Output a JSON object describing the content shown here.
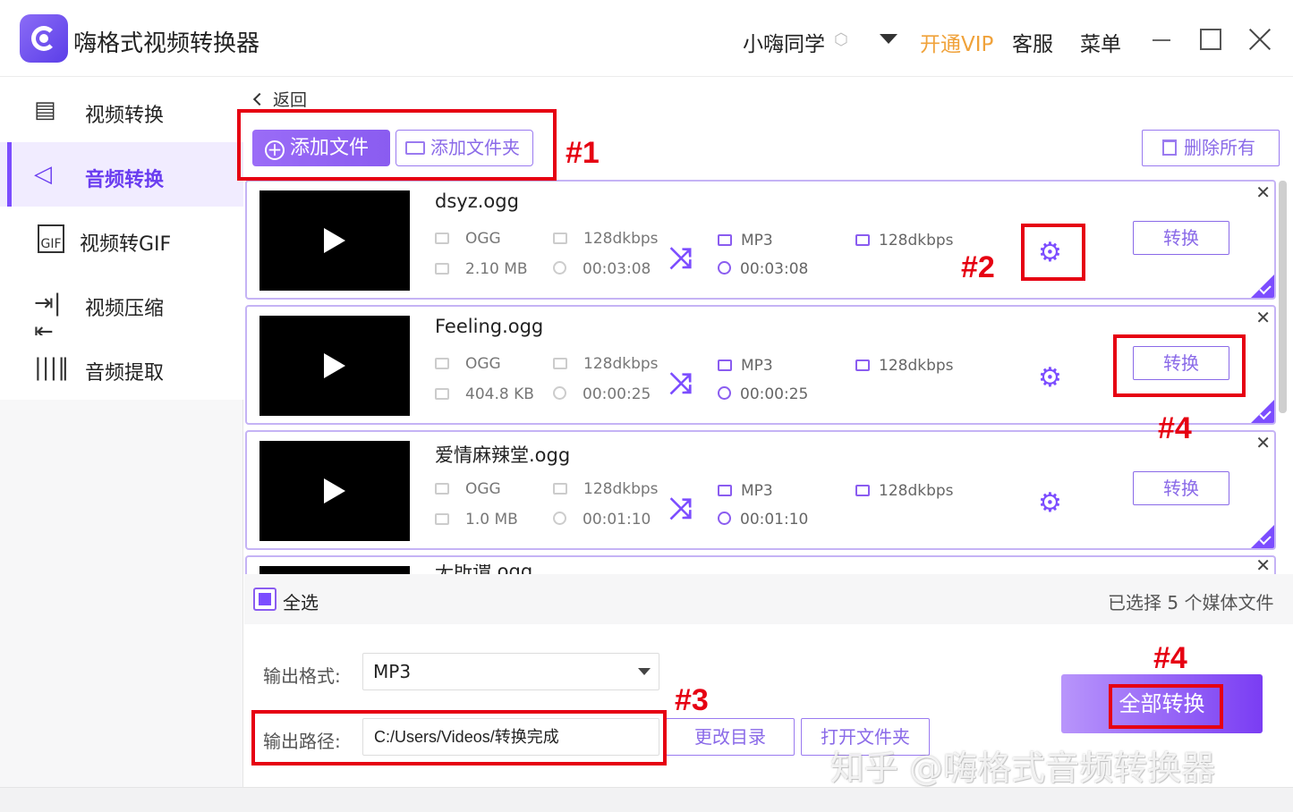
{
  "app": {
    "title": "嗨格式视频转换器",
    "user": "小嗨同学",
    "vip": "开通VIP",
    "service": "客服",
    "menu": "菜单",
    "accent_color": "#7c4dff",
    "vip_color": "#f0a23a"
  },
  "sidebar": {
    "items": [
      {
        "label": "视频转换",
        "icon": "video-convert-icon",
        "active": false
      },
      {
        "label": "音频转换",
        "icon": "audio-convert-icon",
        "active": true
      },
      {
        "label": "视频转GIF",
        "icon": "gif-icon",
        "active": false
      },
      {
        "label": "视频压缩",
        "icon": "compress-icon",
        "active": false
      },
      {
        "label": "音频提取",
        "icon": "audio-extract-icon",
        "active": false
      }
    ]
  },
  "toolbar": {
    "back": "返回",
    "add_file": "添加文件",
    "add_folder": "添加文件夹",
    "delete_all": "删除所有"
  },
  "files": [
    {
      "name": "dsyz.ogg",
      "format": "OGG",
      "bitrate": "128dkbps",
      "size": "2.10 MB",
      "duration": "00:03:08",
      "out_format": "MP3",
      "out_bitrate": "128dkbps",
      "out_duration": "00:03:08",
      "convert": "转换"
    },
    {
      "name": "Feeling.ogg",
      "format": "OGG",
      "bitrate": "128dkbps",
      "size": "404.8 KB",
      "duration": "00:00:25",
      "out_format": "MP3",
      "out_bitrate": "128dkbps",
      "out_duration": "00:00:25",
      "convert": "转换"
    },
    {
      "name": "爱情麻辣堂.ogg",
      "format": "OGG",
      "bitrate": "128dkbps",
      "size": "1.0 MB",
      "duration": "00:01:10",
      "out_format": "MP3",
      "out_bitrate": "128dkbps",
      "out_duration": "00:01:10",
      "convert": "转换"
    },
    {
      "name": "无所谓.ogg"
    }
  ],
  "selection": {
    "select_all": "全选",
    "count_text": "已选择 5 个媒体文件"
  },
  "output": {
    "format_label": "输出格式:",
    "format_value": "MP3",
    "path_label": "输出路径:",
    "path_value": "C:/Users/Videos/转换完成",
    "change_dir": "更改目录",
    "open_folder": "打开文件夹",
    "convert_all": "全部转换"
  },
  "annotations": {
    "a1": "#1",
    "a2": "#2",
    "a3": "#3",
    "a4a": "#4",
    "a4b": "#4"
  },
  "watermark": "知乎 @嗨格式音频转换器"
}
